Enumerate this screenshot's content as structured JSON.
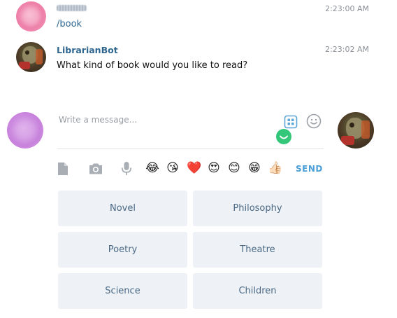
{
  "messages": [
    {
      "sender": "",
      "time": "2:23:00 AM",
      "text": "/book"
    },
    {
      "sender": "LibrarianBot",
      "time": "2:23:02 AM",
      "text": "What kind of book would you like to read?"
    }
  ],
  "composer": {
    "placeholder": "Write a message...",
    "send_label": "SEND"
  },
  "icons": {
    "attach": "file-icon",
    "camera": "camera-icon",
    "mic": "microphone-icon",
    "bot_keyboard": "bot-keyboard-icon",
    "emoji_picker": "smiley-icon"
  },
  "quick_emojis": [
    "😂",
    "😘",
    "❤️",
    "😍",
    "😊",
    "😁",
    "👍🏻"
  ],
  "keyboard": {
    "rows": [
      [
        "Novel",
        "Philosophy"
      ],
      [
        "Poetry",
        "Theatre"
      ],
      [
        "Science",
        "Children"
      ]
    ]
  },
  "colors": {
    "accent": "#4a9fd8",
    "name": "#2f6690",
    "keyboard_button_bg": "#eef2f6",
    "keyboard_button_text": "#4a6884",
    "online_badge": "#34c77a"
  }
}
